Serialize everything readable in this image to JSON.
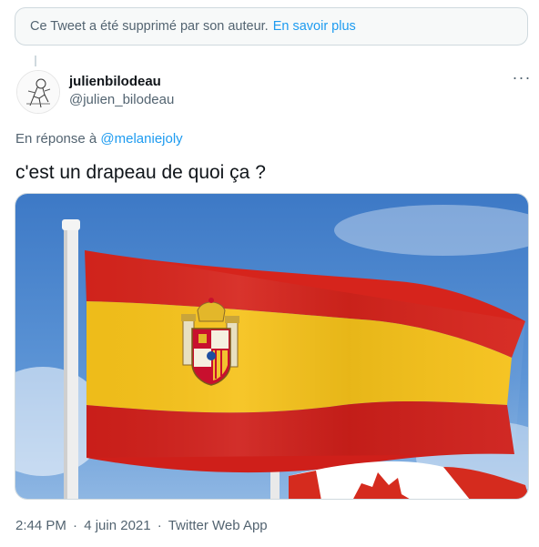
{
  "deleted_notice": {
    "text": "Ce Tweet a été supprimé par son auteur.",
    "link": "En savoir plus"
  },
  "tweet": {
    "display_name": "julienbilodeau",
    "handle": "@julien_bilodeau",
    "more_label": "···",
    "reply_prefix": "En réponse à",
    "reply_to": "@melaniejoly",
    "text": "c'est un drapeau de quoi ça ?",
    "time": "2:44 PM",
    "date": "4 juin 2021",
    "separator": "·",
    "source": "Twitter Web App"
  },
  "media": {
    "subject": "spain-flag-photo",
    "colors": {
      "red": "#d6241c",
      "yellow": "#f6c21a",
      "sky": "#4a86d0"
    }
  }
}
